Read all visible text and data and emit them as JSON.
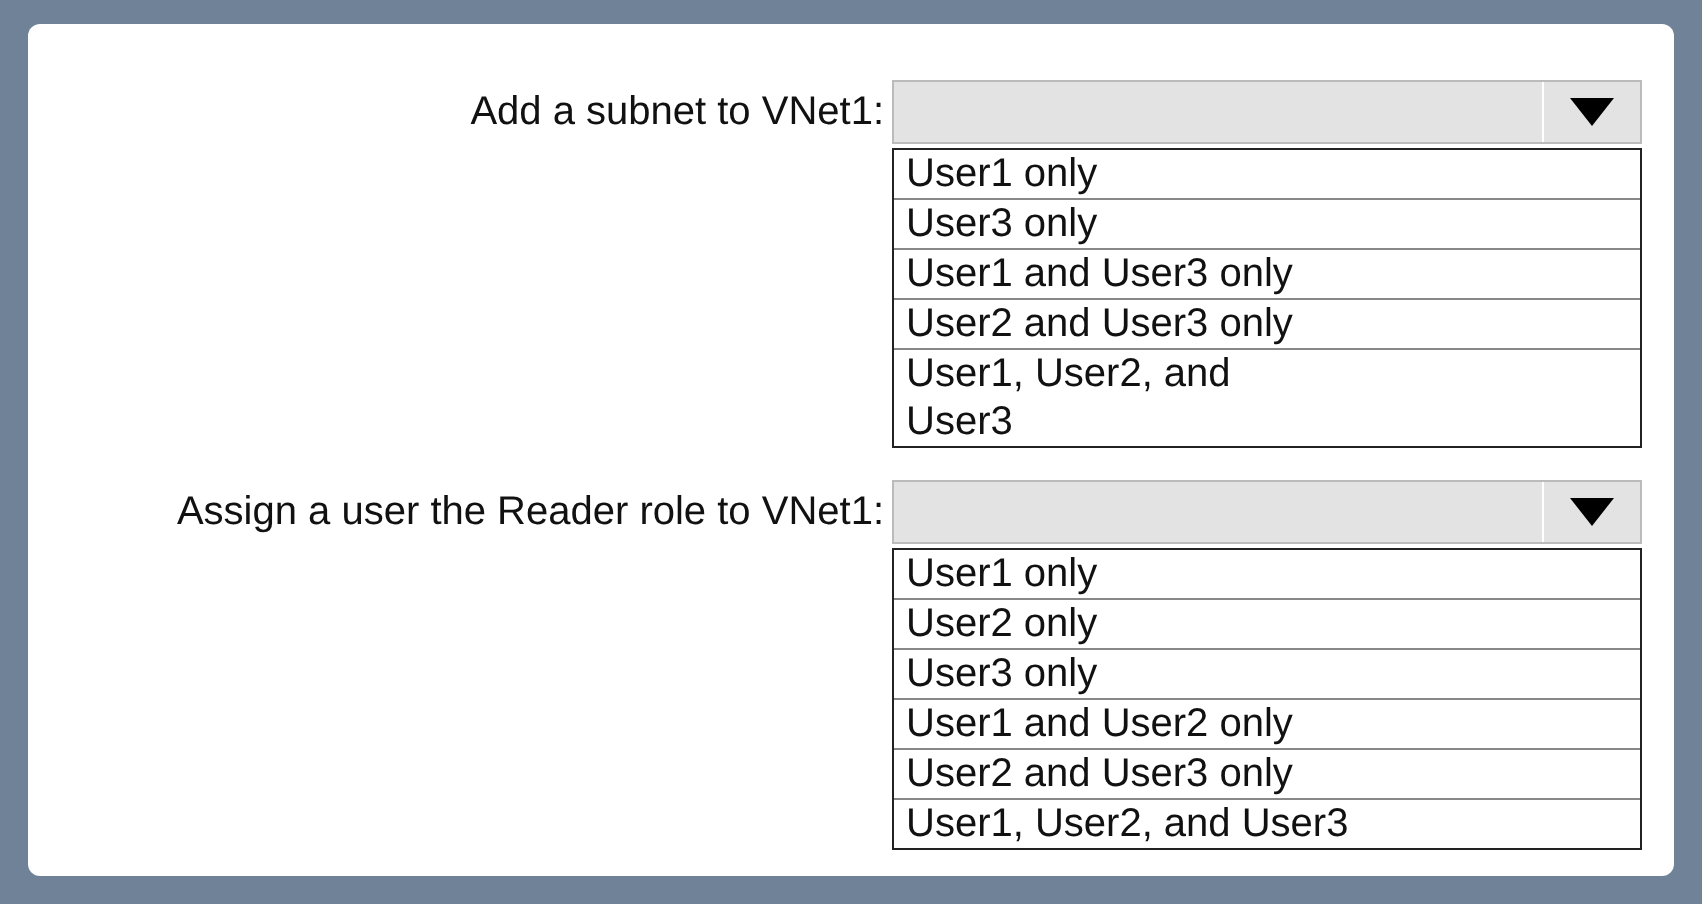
{
  "questions": [
    {
      "label": "Add a subnet to VNet1:",
      "options": [
        {
          "lines": [
            "User1 only"
          ]
        },
        {
          "lines": [
            "User3 only"
          ]
        },
        {
          "lines": [
            "User1 and User3 only"
          ]
        },
        {
          "lines": [
            "User2 and User3 only"
          ]
        },
        {
          "lines": [
            "User1, User2, and",
            "User3"
          ]
        }
      ]
    },
    {
      "label": "Assign a user the Reader role to VNet1:",
      "options": [
        {
          "lines": [
            "User1 only"
          ]
        },
        {
          "lines": [
            "User2 only"
          ]
        },
        {
          "lines": [
            "User3 only"
          ]
        },
        {
          "lines": [
            "User1 and User2 only"
          ]
        },
        {
          "lines": [
            "User2 and User3 only"
          ]
        },
        {
          "lines": [
            "User1, User2, and User3"
          ]
        }
      ]
    }
  ]
}
